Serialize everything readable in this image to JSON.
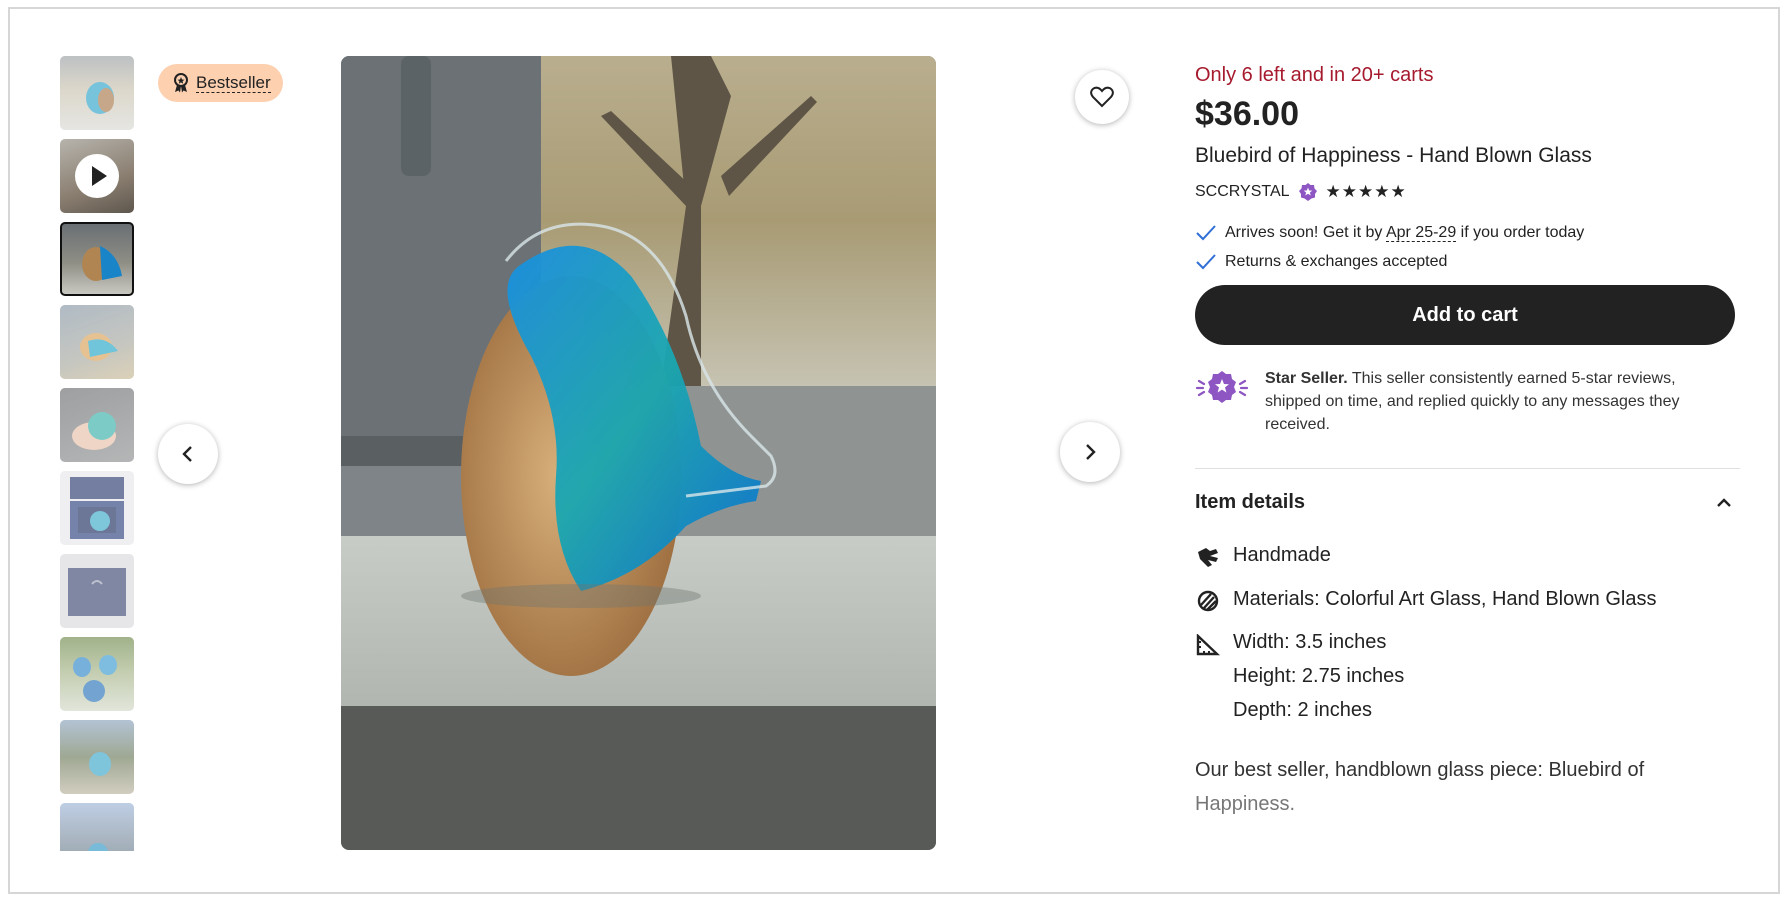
{
  "badge": {
    "label": "Bestseller"
  },
  "thumbnails": [
    {
      "name": "bird-on-sill",
      "kind": "image"
    },
    {
      "name": "video",
      "kind": "video"
    },
    {
      "name": "bird-closeup",
      "kind": "image",
      "active": true
    },
    {
      "name": "bird-side",
      "kind": "image"
    },
    {
      "name": "bird-in-hand",
      "kind": "image"
    },
    {
      "name": "bird-in-box",
      "kind": "image"
    },
    {
      "name": "gift-box",
      "kind": "image"
    },
    {
      "name": "birds-group",
      "kind": "image"
    },
    {
      "name": "bird-outdoors",
      "kind": "image"
    },
    {
      "name": "bird-landscape",
      "kind": "image"
    }
  ],
  "listing": {
    "stock": "Only 6 left and in 20+ carts",
    "price": "$36.00",
    "title": "Bluebird of Happiness - Hand Blown Glass",
    "seller": "SCCRYSTAL",
    "stars": "★★★★★",
    "rating": 5
  },
  "delivery": {
    "arrives_prefix": "Arrives soon! Get it by ",
    "arrives_dates": "Apr 25-29",
    "arrives_suffix": " if you order today",
    "returns": "Returns & exchanges accepted"
  },
  "cart": {
    "label": "Add to cart"
  },
  "star_seller": {
    "title": "Star Seller.",
    "text": " This seller consistently earned 5-star reviews, shipped on time, and replied quickly to any messages they received."
  },
  "details": {
    "heading": "Item details",
    "handmade": "Handmade",
    "materials": "Materials: Colorful Art Glass, Hand Blown Glass",
    "width": "Width: 3.5 inches",
    "height": "Height: 2.75 inches",
    "depth": "Depth: 2 inches"
  },
  "description": {
    "line1": "Our best seller, handblown glass piece: Bluebird of",
    "line2": "Happiness."
  },
  "colors": {
    "accent_red": "#a61a2e",
    "badge_bg": "#fdd0b0",
    "star_purple": "#8e56c2"
  }
}
